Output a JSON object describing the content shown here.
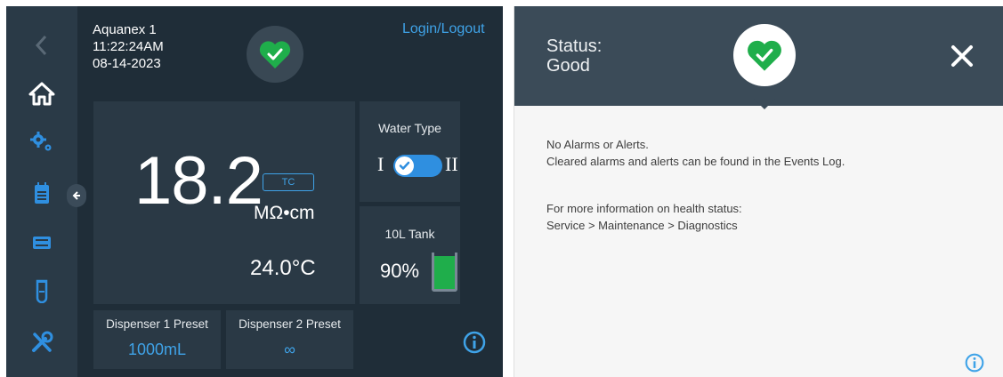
{
  "header": {
    "device_name": "Aquanex 1",
    "time": "11:22:24AM",
    "date": "08-14-2023",
    "login_label": "Login/Logout"
  },
  "sidebar": {
    "items": [
      {
        "icon": "back-arrow-icon"
      },
      {
        "icon": "home-icon"
      },
      {
        "icon": "settings-gears-icon"
      },
      {
        "icon": "events-log-icon"
      },
      {
        "icon": "dispense-icon"
      },
      {
        "icon": "sample-tube-icon"
      },
      {
        "icon": "service-tools-icon"
      }
    ]
  },
  "main": {
    "resistivity_value": "18.2",
    "resistivity_unit": "MΩ•cm",
    "tc_label": "TC",
    "temperature": "24.0°C"
  },
  "water_type": {
    "title": "Water Type",
    "left_label": "I",
    "right_label": "II",
    "selected": "I"
  },
  "tank": {
    "title": "10L Tank",
    "level_text": "90%",
    "level_fraction": 0.9
  },
  "presets": [
    {
      "title": "Dispenser 1 Preset",
      "value": "1000mL"
    },
    {
      "title": "Dispenser 2 Preset",
      "value": "∞"
    }
  ],
  "status_panel": {
    "status_label": "Status:",
    "status_value": "Good",
    "message_1": "No Alarms or Alerts.",
    "message_2": "Cleared alarms and alerts can be found in the Events Log.",
    "message_3": "For more information on health status:",
    "message_4": "Service > Maintenance > Diagnostics"
  },
  "colors": {
    "accent_blue": "#3fa3e8",
    "health_green": "#1fae4b",
    "panel_dark": "#1f2d38",
    "card_dark": "#2a3945"
  }
}
